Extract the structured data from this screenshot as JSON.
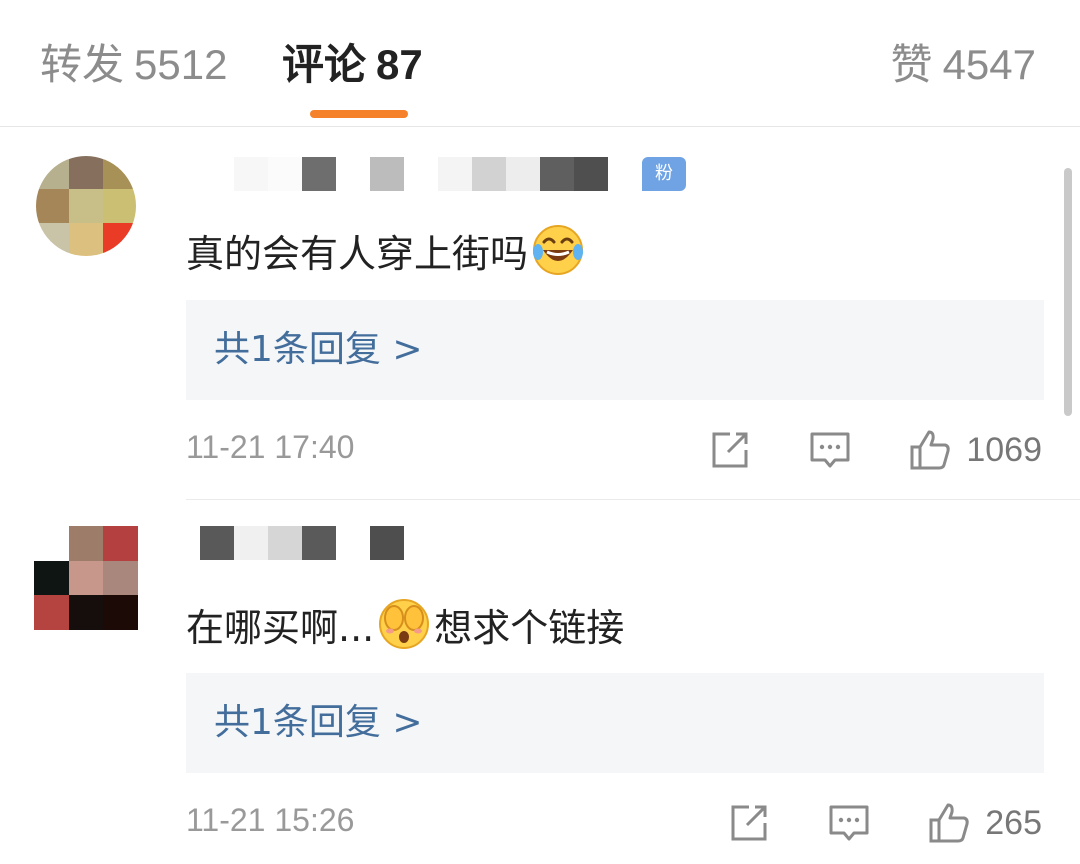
{
  "tabs": [
    {
      "label": "转发",
      "count": "5512"
    },
    {
      "label": "评论",
      "count": "87"
    },
    {
      "label": "赞",
      "count": "4547"
    }
  ],
  "colors": {
    "accent": "#f5822a",
    "link": "#436e9c",
    "fan_badge": "#6fa3e3",
    "reply_bg": "#f5f6f8"
  },
  "comments": [
    {
      "fan_badge": "粉",
      "text_before": "真的会有人穿上街吗",
      "emoji": "laughing-tears-emoji",
      "text_after": "",
      "reply_link": "共1条回复 >",
      "timestamp": "11-21 17:40",
      "likes": "1069"
    },
    {
      "fan_badge": "",
      "text_before": "在哪买啊...",
      "emoji": "cover-eyes-emoji",
      "text_after": "想求个链接",
      "reply_link": "共1条回复 >",
      "timestamp": "11-21 15:26",
      "likes": "265"
    }
  ],
  "icons": {
    "share": "share-icon",
    "comment": "comment-icon",
    "like": "thumbs-up-icon"
  }
}
